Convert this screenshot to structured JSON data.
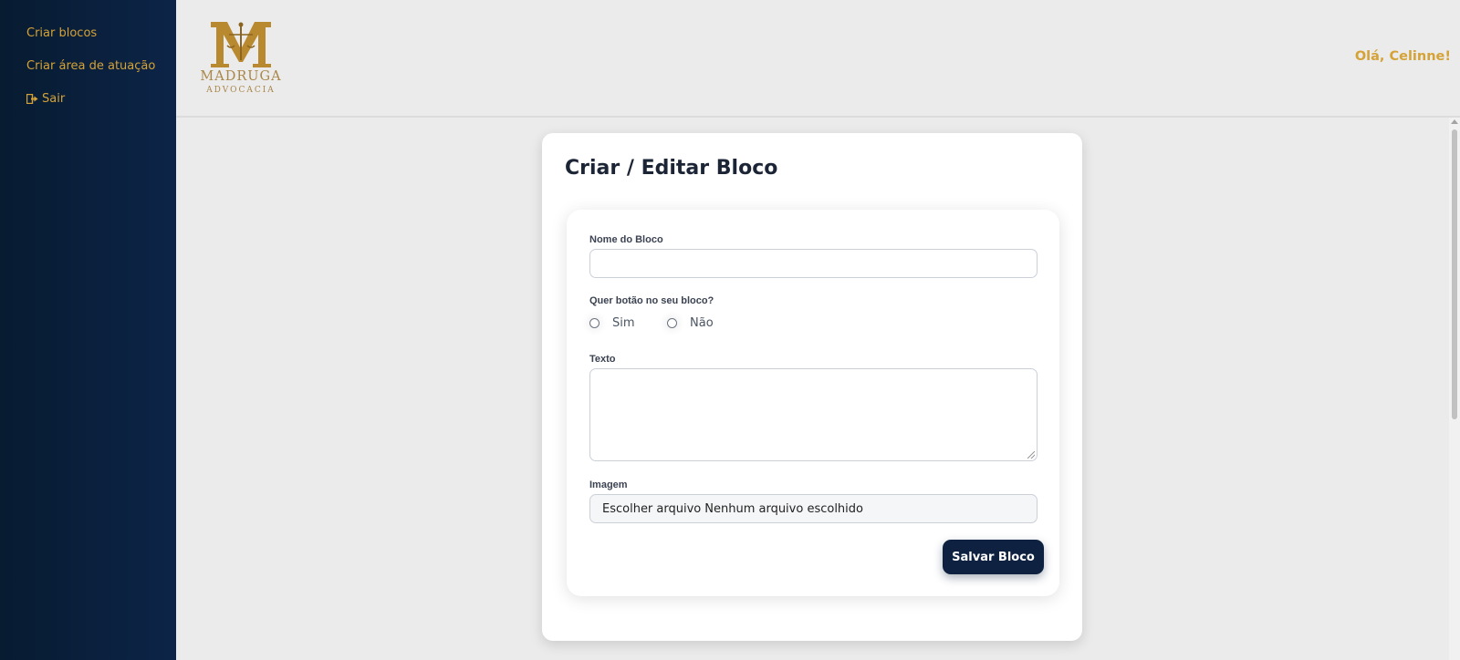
{
  "sidebar": {
    "items": [
      {
        "label": "Criar blocos"
      },
      {
        "label": "Criar área de atuação"
      },
      {
        "label": "Sair",
        "icon": "sign-out-icon"
      }
    ]
  },
  "header": {
    "logo_name": "MADRUGA",
    "logo_sub": "ADVOCACIA",
    "greeting": "Olá, Celinne!"
  },
  "form": {
    "title": "Criar / Editar Bloco",
    "name_label": "Nome do Bloco",
    "name_value": "",
    "button_question": "Quer botão no seu bloco?",
    "options": [
      {
        "label": "Sim",
        "checked": false
      },
      {
        "label": "Não",
        "checked": false
      }
    ],
    "text_label": "Texto",
    "text_value": "",
    "image_label": "Imagem",
    "file_button": "Escolher arquivo",
    "file_status": "Nenhum arquivo escolhido",
    "save_label": "Salvar Bloco"
  },
  "colors": {
    "sidebar_bg": "#0a2040",
    "accent_gold": "#d4a237",
    "primary_button": "#0f2140"
  }
}
